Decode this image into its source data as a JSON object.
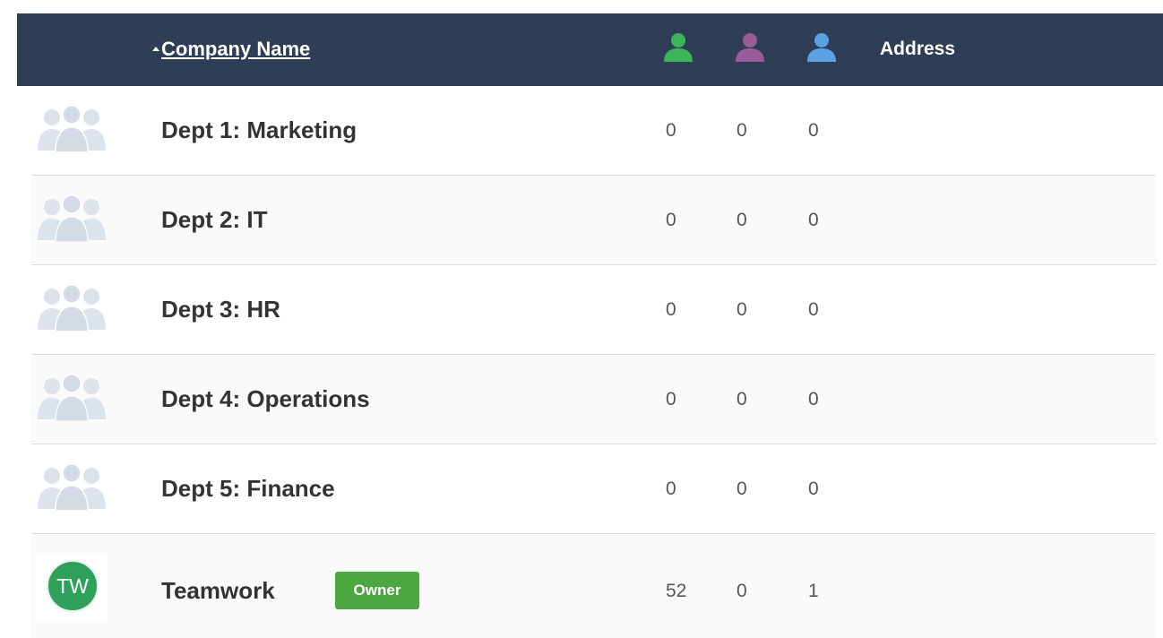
{
  "header": {
    "sort_column_label": "Company Name",
    "icons": [
      {
        "name": "green-user-icon",
        "color": "#3cb55a"
      },
      {
        "name": "purple-user-icon",
        "color": "#9a5c99"
      },
      {
        "name": "blue-user-icon",
        "color": "#5aa3e2"
      }
    ],
    "address_label": "Address"
  },
  "rows": [
    {
      "name": "Dept 1: Marketing",
      "c1": "0",
      "c2": "0",
      "c3": "0"
    },
    {
      "name": "Dept 2: IT",
      "c1": "0",
      "c2": "0",
      "c3": "0"
    },
    {
      "name": "Dept 3: HR",
      "c1": "0",
      "c2": "0",
      "c3": "0"
    },
    {
      "name": "Dept 4: Operations",
      "c1": "0",
      "c2": "0",
      "c3": "0"
    },
    {
      "name": "Dept 5: Finance",
      "c1": "0",
      "c2": "0",
      "c3": "0"
    },
    {
      "name": "Teamwork",
      "initials": "TW",
      "badge": "Owner",
      "c1": "52",
      "c2": "0",
      "c3": "1"
    }
  ],
  "colors": {
    "header_bg": "#2f3e56",
    "owner_badge": "#4ba740",
    "avatar_circle": "#2fa05a",
    "placeholder_avatar": "#dde3ea"
  }
}
